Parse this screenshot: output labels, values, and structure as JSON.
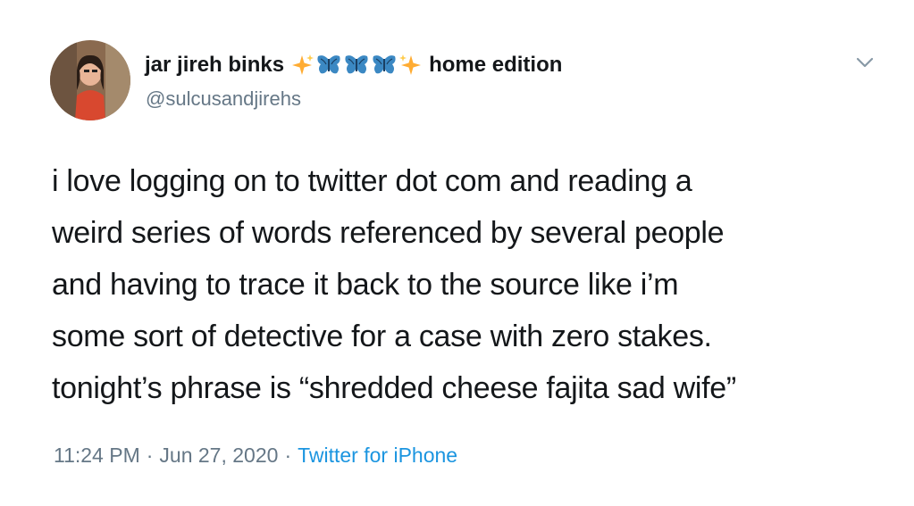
{
  "author": {
    "display_name": "jar jireh binks",
    "name_suffix": "home edition",
    "handle": "@sulcusandjirehs",
    "name_emojis": [
      "sparkles-icon",
      "butterfly-icon",
      "butterfly-icon",
      "butterfly-icon",
      "sparkles-icon"
    ]
  },
  "tweet": {
    "text_lines": [
      "i love logging on to twitter dot com and reading a",
      "weird series of words referenced by several people",
      "and having to trace it back to the source like i’m",
      "some sort of detective for a case with zero stakes.",
      "tonight’s phrase is “shredded cheese fajita sad wife”"
    ],
    "time": "11:24 PM",
    "date": "Jun 27, 2020",
    "separator": "·",
    "source": "Twitter for iPhone"
  },
  "colors": {
    "text": "#14171a",
    "secondary": "#657786",
    "link": "#1b95e0",
    "butterfly": "#3b88c3",
    "sparkle": "#ffac33"
  }
}
